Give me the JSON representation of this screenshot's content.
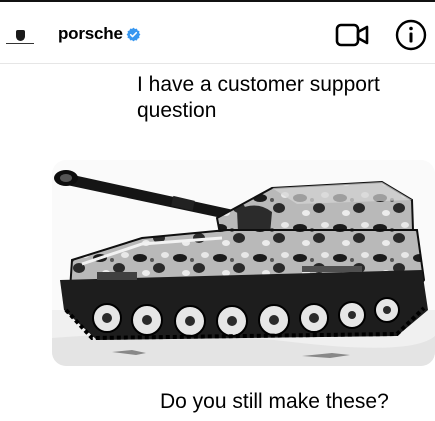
{
  "header": {
    "username": "porsche",
    "verified": true,
    "icons": {
      "video": "video-camera-icon",
      "info": "info-circle-icon",
      "verified": "verified-badge-icon"
    },
    "accent_color": "#3897f0"
  },
  "messages": [
    {
      "text": "I have a customer support question",
      "type": "text"
    },
    {
      "type": "image",
      "subject": "tank-photo"
    },
    {
      "text": "Do you still make these?",
      "type": "text"
    }
  ]
}
